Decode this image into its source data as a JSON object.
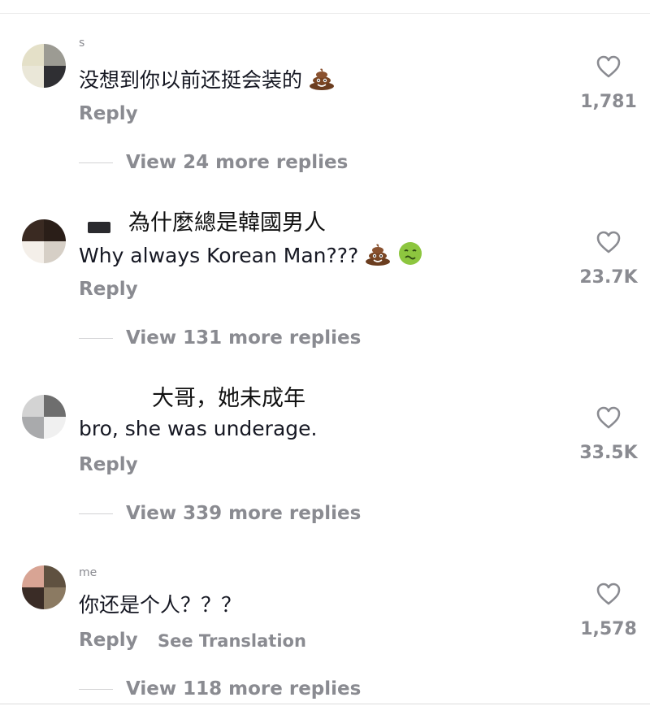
{
  "comments": [
    {
      "username": "s",
      "text": "没想到你以前还挺会装的",
      "emojis": [
        "pile-of-poo"
      ],
      "reply_label": "Reply",
      "likes": "1,781",
      "view_more": "View 24 more replies",
      "colors": [
        "#e4e0c8",
        "#9c9b93",
        "#eae7d8",
        "#2f2f33"
      ]
    },
    {
      "overlay_text": "為什麼總是韓國男人",
      "text": "Why always Korean Man???",
      "emojis": [
        "pile-of-poo",
        "nauseated-face"
      ],
      "reply_label": "Reply",
      "likes": "23.7K",
      "view_more": "View 131 more replies",
      "colors": [
        "#3a2a22",
        "#2a1e18",
        "#f4efe9",
        "#d6cfc6"
      ]
    },
    {
      "overlay_text": "大哥，她未成年",
      "text": "bro, she was underage.",
      "emojis": [],
      "reply_label": "Reply",
      "likes": "33.5K",
      "view_more": "View 339 more replies",
      "colors": [
        "#d3d3d3",
        "#6e6e6e",
        "#a9aaac",
        "#f0f0f0"
      ]
    },
    {
      "username": "me",
      "text": "你还是个人？？？",
      "emojis": [],
      "reply_label": "Reply",
      "see_translation": "See Translation",
      "likes": "1,578",
      "view_more": "View 118 more replies",
      "colors": [
        "#d8a494",
        "#5f5140",
        "#3a2c26",
        "#8b7a62"
      ]
    }
  ],
  "icons": {
    "like": "heart-outline-icon",
    "emoji_1": "pile-of-poo-emoji",
    "emoji_2": "nauseated-face-emoji"
  }
}
